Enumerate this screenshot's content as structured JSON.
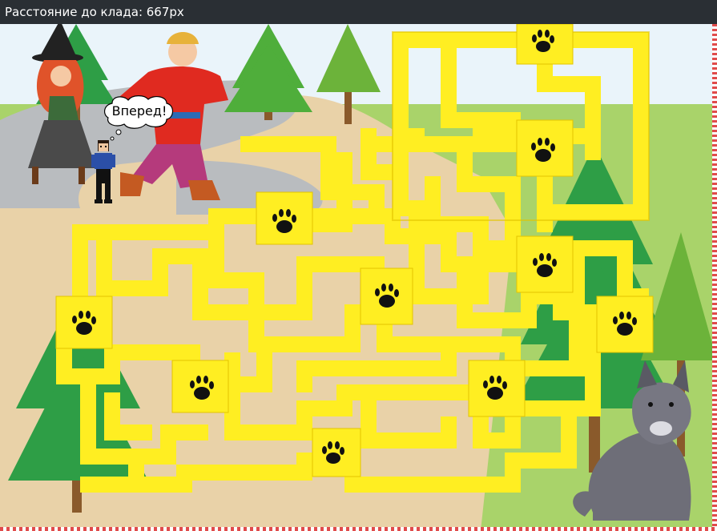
{
  "hud": {
    "distance_label": "Расстояние до клада: 667px"
  },
  "speech": {
    "text": "Вперед!"
  },
  "colors": {
    "topbar": "#2a2f34",
    "maze": "#ffee22",
    "maze_edge": "#e3c400",
    "paw": "#111111",
    "grass": "#8dc63f",
    "path": "#e9d2a8",
    "road": "#b9bcbf",
    "sky": "#eaf4fa"
  },
  "icons": {
    "paw": "paw-print-icon",
    "speech": "speech-bubble-icon"
  },
  "game": {
    "characters": [
      "witch",
      "ivan",
      "player",
      "wolf"
    ]
  }
}
